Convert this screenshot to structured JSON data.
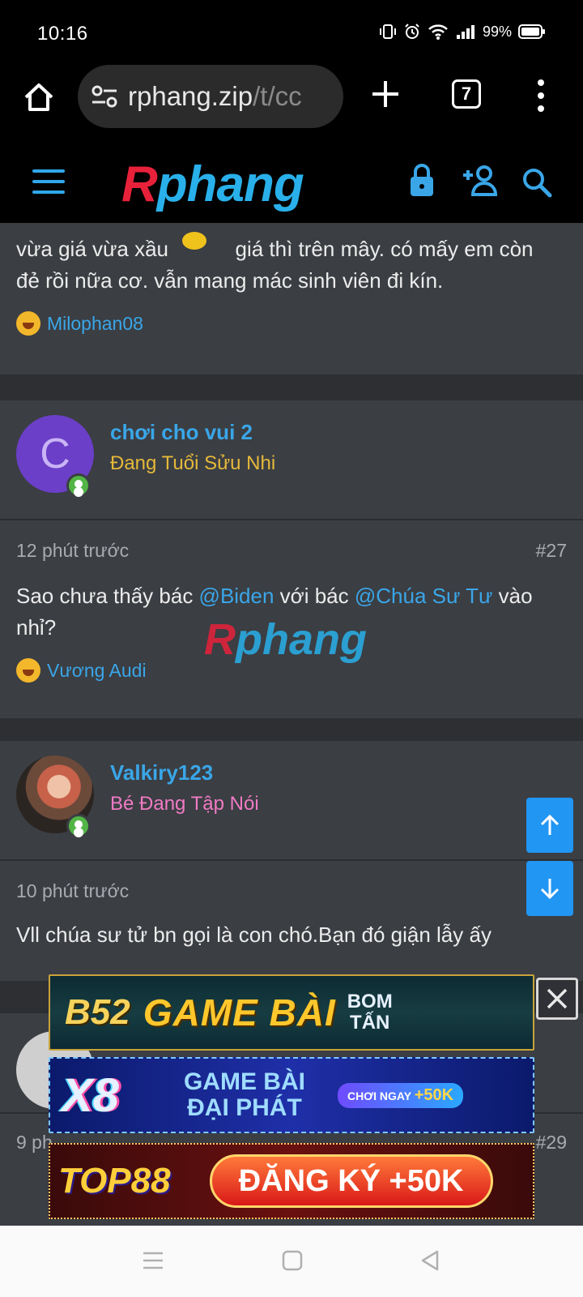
{
  "status": {
    "time": "10:16",
    "battery": "99%"
  },
  "browser": {
    "url_host": "rphang.zip",
    "url_path": "/t/cc",
    "tab_count": "7"
  },
  "site": {
    "logo_red": "R",
    "logo_blue": "phang"
  },
  "posts": [
    {
      "text_top": "vừa giá vừa xầu",
      "text_top2": "giá thì trên mây. có mấy em còn",
      "text_line2": "đẻ rồi nữa cơ. vẫn mang mác sinh viên đi kín.",
      "reaction_user": "Milophan08"
    },
    {
      "avatar_letter": "C",
      "username": "chơi cho vui 2",
      "user_title": "Đang Tuổi Sửu Nhi",
      "time": "12 phút trước",
      "number": "#27",
      "text_1": "Sao chưa thấy bác ",
      "mention_1": "@Biden",
      "text_2": " với bác ",
      "mention_2": "@Chúa Sư Tư",
      "text_3": " vào",
      "text_4": "nhỉ?",
      "reaction_user": "Vương Audi"
    },
    {
      "username": "Valkiry123",
      "user_title": "Bé Đang Tập Nói",
      "time": "10 phút trước",
      "text": "Vll chúa sư tử bn gọi là con chó.Bạn đó giận lẫy ấy"
    },
    {
      "time": "9 ph",
      "number": "#29"
    }
  ],
  "ads": {
    "b52": {
      "logo": "B52",
      "headline": "GAME BÀI",
      "tag1": "BOM",
      "tag2": "TẤN"
    },
    "x8": {
      "logo": "X8",
      "line1": "GAME BÀI",
      "line2": "ĐẠI PHÁT",
      "pill": "CHƠI NGAY",
      "bonus": "+50K"
    },
    "top88": {
      "logo": "TOP88",
      "cta": "ĐĂNG KÝ +50K"
    }
  },
  "colors": {
    "accent": "#3aa6e8",
    "title_yellow": "#e6b93a",
    "title_pink": "#f07bc4",
    "scroll_btn": "#2196f3"
  }
}
